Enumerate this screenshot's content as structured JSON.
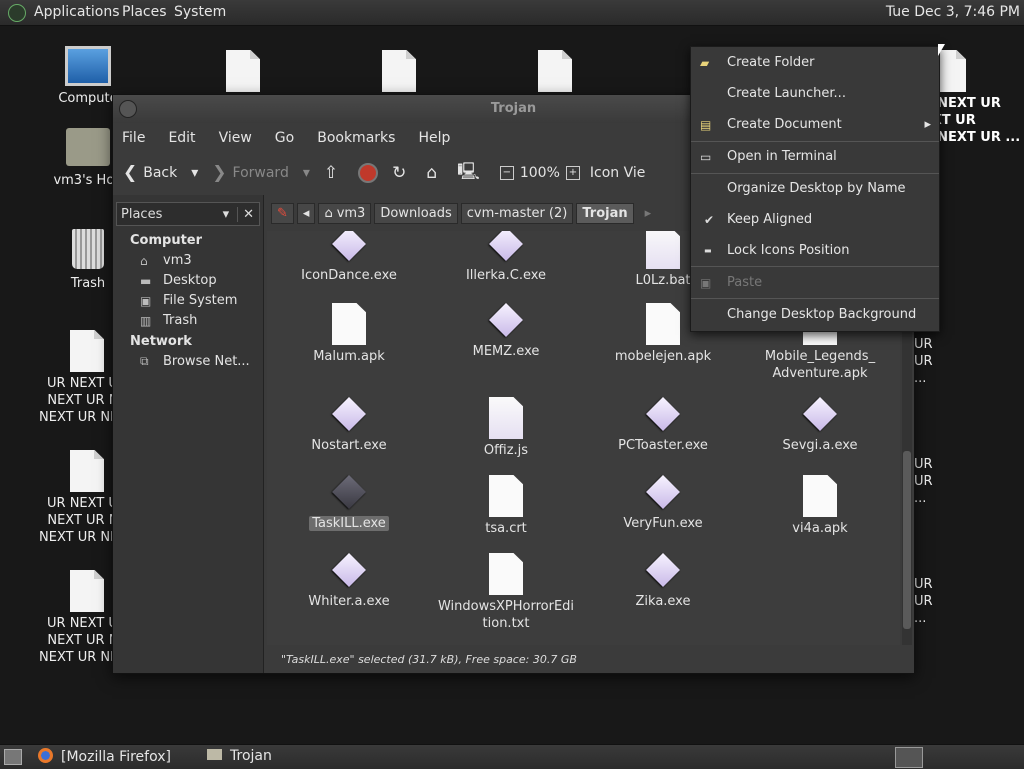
{
  "top_panel": {
    "menus": [
      "Applications",
      "Places",
      "System"
    ],
    "clock": "Tue Dec  3,  7:46 PM"
  },
  "desktop": {
    "computer": "Compute",
    "home": "vm3's Hon",
    "trash": "Trash",
    "text_file": "UR NEXT UR\nNEXT UR NE\nNEXT UR NEXT",
    "right_labels": [
      "UR NEXT UR\nNEXT UR\nUR NEXT UR ..."
    ],
    "right_edge": [
      "UR\nUR\n...",
      "UR\nUR\n...",
      "UR\nUR\n..."
    ]
  },
  "window": {
    "title": "Trojan",
    "menu": [
      "File",
      "Edit",
      "View",
      "Go",
      "Bookmarks",
      "Help"
    ],
    "toolbar": {
      "back": "Back",
      "forward": "Forward",
      "zoom": "100%",
      "view_mode": "Icon Vie"
    },
    "sidebar": {
      "selector": "Places",
      "sections": [
        {
          "heading": "Computer",
          "items": [
            "vm3",
            "Desktop",
            "File System",
            "Trash"
          ]
        },
        {
          "heading": "Network",
          "items": [
            "Browse Net..."
          ]
        }
      ]
    },
    "breadcrumbs": [
      "vm3",
      "Downloads",
      "cvm-master (2)",
      "Trojan"
    ],
    "files": [
      {
        "name": "IconDance.exe",
        "kind": "exe"
      },
      {
        "name": "Illerka.C.exe",
        "kind": "exe"
      },
      {
        "name": "L0Lz.bat",
        "kind": "script"
      },
      {
        "name": "",
        "kind": "hidden"
      },
      {
        "name": "Malum.apk",
        "kind": "doc"
      },
      {
        "name": "MEMZ.exe",
        "kind": "exe"
      },
      {
        "name": "mobelejen.apk",
        "kind": "doc"
      },
      {
        "name": "Mobile_Legends_\nAdventure.apk",
        "kind": "doc"
      },
      {
        "name": "Nostart.exe",
        "kind": "exe"
      },
      {
        "name": "Offiz.js",
        "kind": "script"
      },
      {
        "name": "PCToaster.exe",
        "kind": "exe"
      },
      {
        "name": "Sevgi.a.exe",
        "kind": "exe"
      },
      {
        "name": "TaskILL.exe",
        "kind": "exe-selected"
      },
      {
        "name": "tsa.crt",
        "kind": "doc"
      },
      {
        "name": "VeryFun.exe",
        "kind": "exe"
      },
      {
        "name": "vi4a.apk",
        "kind": "doc"
      },
      {
        "name": "Whiter.a.exe",
        "kind": "exe"
      },
      {
        "name": "WindowsXPHorrorEdi\ntion.txt",
        "kind": "doc"
      },
      {
        "name": "Zika.exe",
        "kind": "exe"
      }
    ],
    "status": "\"TaskILL.exe\" selected (31.7 kB), Free space: 30.7 GB"
  },
  "context_menu": {
    "items": [
      {
        "label": "Create Folder",
        "icon": "new-folder-icon",
        "disabled": false
      },
      {
        "label": "Create Launcher...",
        "icon": "",
        "disabled": false
      },
      {
        "label": "Create Document",
        "icon": "document-icon",
        "disabled": false,
        "submenu": true
      },
      {
        "label": "Open in Terminal",
        "icon": "terminal-icon",
        "disabled": false
      },
      {
        "label": "Organize Desktop by Name",
        "icon": "",
        "disabled": false
      },
      {
        "label": "Keep Aligned",
        "icon": "check-icon",
        "disabled": false
      },
      {
        "label": "Lock Icons Position",
        "icon": "",
        "disabled": false
      },
      {
        "label": "Paste",
        "icon": "clipboard-icon",
        "disabled": true
      },
      {
        "label": "Change Desktop Background",
        "icon": "",
        "disabled": false
      }
    ]
  },
  "taskbar": {
    "tasks": [
      "[Mozilla Firefox]",
      "Trojan"
    ]
  }
}
